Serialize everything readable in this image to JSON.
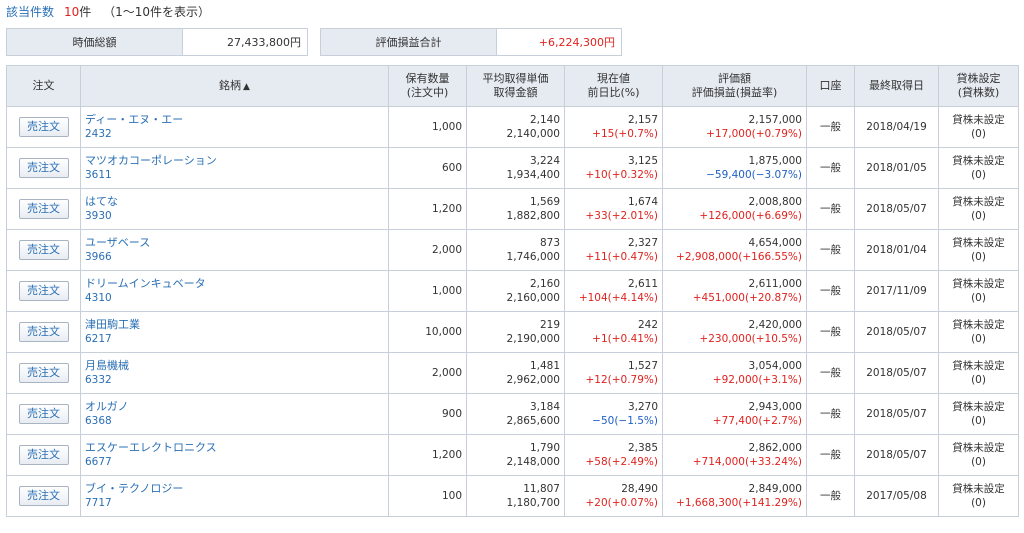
{
  "header": {
    "count_label": "該当件数",
    "count_value": "10",
    "count_unit": "件",
    "count_range": "（1〜10件を表示）"
  },
  "summary": {
    "market_value_label": "時価総額",
    "market_value": "27,433,800円",
    "pnl_label": "評価損益合計",
    "pnl_value": "+6,224,300円"
  },
  "columns": {
    "order": "注文",
    "name": "銘柄",
    "sort_indicator": "▲",
    "qty": "保有数量",
    "qty_sub": "(注文中)",
    "avg": "平均取得単価",
    "avg_sub": "取得金額",
    "cur": "現在値",
    "cur_sub": "前日比(%)",
    "val": "評価額",
    "val_sub": "評価損益(損益率)",
    "acct": "口座",
    "date": "最終取得日",
    "lend": "貸株設定",
    "lend_sub": "(貸株数)"
  },
  "sell_label": "売注文",
  "rows": [
    {
      "name": "ディー・エヌ・エー",
      "code": "2432",
      "qty": "1,000",
      "avg_price": "2,140",
      "cost": "2,140,000",
      "price": "2,157",
      "change": "+15(+0.7%)",
      "change_dir": "pos",
      "value": "2,157,000",
      "pnl": "+17,000(+0.79%)",
      "pnl_dir": "pos",
      "account": "一般",
      "date": "2018/04/19",
      "lend": "貸株未設定",
      "lend_qty": "(0)"
    },
    {
      "name": "マツオカコーポレーション",
      "code": "3611",
      "qty": "600",
      "avg_price": "3,224",
      "cost": "1,934,400",
      "price": "3,125",
      "change": "+10(+0.32%)",
      "change_dir": "pos",
      "value": "1,875,000",
      "pnl": "−59,400(−3.07%)",
      "pnl_dir": "neg",
      "account": "一般",
      "date": "2018/01/05",
      "lend": "貸株未設定",
      "lend_qty": "(0)"
    },
    {
      "name": "はてな",
      "code": "3930",
      "qty": "1,200",
      "avg_price": "1,569",
      "cost": "1,882,800",
      "price": "1,674",
      "change": "+33(+2.01%)",
      "change_dir": "pos",
      "value": "2,008,800",
      "pnl": "+126,000(+6.69%)",
      "pnl_dir": "pos",
      "account": "一般",
      "date": "2018/05/07",
      "lend": "貸株未設定",
      "lend_qty": "(0)"
    },
    {
      "name": "ユーザベース",
      "code": "3966",
      "qty": "2,000",
      "avg_price": "873",
      "cost": "1,746,000",
      "price": "2,327",
      "change": "+11(+0.47%)",
      "change_dir": "pos",
      "value": "4,654,000",
      "pnl": "+2,908,000(+166.55%)",
      "pnl_dir": "pos",
      "account": "一般",
      "date": "2018/01/04",
      "lend": "貸株未設定",
      "lend_qty": "(0)"
    },
    {
      "name": "ドリームインキュベータ",
      "code": "4310",
      "qty": "1,000",
      "avg_price": "2,160",
      "cost": "2,160,000",
      "price": "2,611",
      "change": "+104(+4.14%)",
      "change_dir": "pos",
      "value": "2,611,000",
      "pnl": "+451,000(+20.87%)",
      "pnl_dir": "pos",
      "account": "一般",
      "date": "2017/11/09",
      "lend": "貸株未設定",
      "lend_qty": "(0)"
    },
    {
      "name": "津田駒工業",
      "code": "6217",
      "qty": "10,000",
      "avg_price": "219",
      "cost": "2,190,000",
      "price": "242",
      "change": "+1(+0.41%)",
      "change_dir": "pos",
      "value": "2,420,000",
      "pnl": "+230,000(+10.5%)",
      "pnl_dir": "pos",
      "account": "一般",
      "date": "2018/05/07",
      "lend": "貸株未設定",
      "lend_qty": "(0)"
    },
    {
      "name": "月島機械",
      "code": "6332",
      "qty": "2,000",
      "avg_price": "1,481",
      "cost": "2,962,000",
      "price": "1,527",
      "change": "+12(+0.79%)",
      "change_dir": "pos",
      "value": "3,054,000",
      "pnl": "+92,000(+3.1%)",
      "pnl_dir": "pos",
      "account": "一般",
      "date": "2018/05/07",
      "lend": "貸株未設定",
      "lend_qty": "(0)"
    },
    {
      "name": "オルガノ",
      "code": "6368",
      "qty": "900",
      "avg_price": "3,184",
      "cost": "2,865,600",
      "price": "3,270",
      "change": "−50(−1.5%)",
      "change_dir": "neg",
      "value": "2,943,000",
      "pnl": "+77,400(+2.7%)",
      "pnl_dir": "pos",
      "account": "一般",
      "date": "2018/05/07",
      "lend": "貸株未設定",
      "lend_qty": "(0)"
    },
    {
      "name": "エスケーエレクトロニクス",
      "code": "6677",
      "qty": "1,200",
      "avg_price": "1,790",
      "cost": "2,148,000",
      "price": "2,385",
      "change": "+58(+2.49%)",
      "change_dir": "pos",
      "value": "2,862,000",
      "pnl": "+714,000(+33.24%)",
      "pnl_dir": "pos",
      "account": "一般",
      "date": "2018/05/07",
      "lend": "貸株未設定",
      "lend_qty": "(0)"
    },
    {
      "name": "ブイ・テクノロジー",
      "code": "7717",
      "qty": "100",
      "avg_price": "11,807",
      "cost": "1,180,700",
      "price": "28,490",
      "change": "+20(+0.07%)",
      "change_dir": "pos",
      "value": "2,849,000",
      "pnl": "+1,668,300(+141.29%)",
      "pnl_dir": "pos",
      "account": "一般",
      "date": "2017/05/08",
      "lend": "貸株未設定",
      "lend_qty": "(0)"
    }
  ]
}
